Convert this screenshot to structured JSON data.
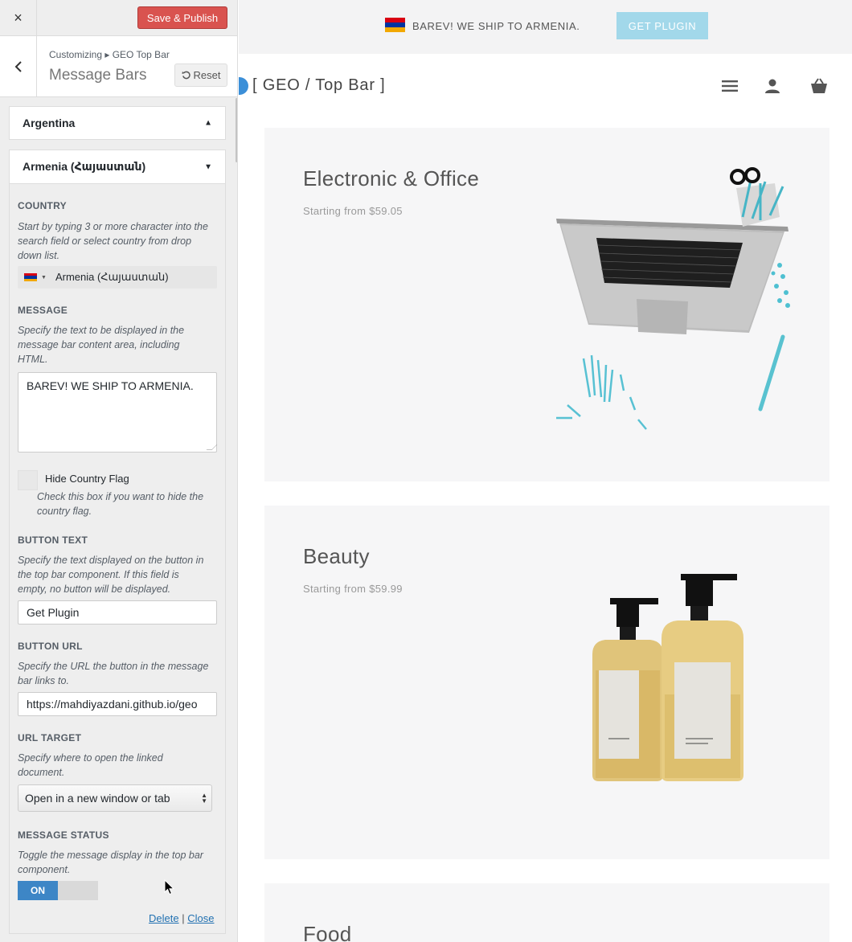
{
  "customizer": {
    "close_icon": "×",
    "save_label": "Save & Publish",
    "breadcrumb": "Customizing ▸ GEO Top Bar",
    "section_title": "Message Bars",
    "reset_label": "Reset",
    "accordions": [
      {
        "title": "Argentina",
        "state": "collapsed"
      },
      {
        "title": "Armenia (Հայաստան)",
        "state": "expanded"
      }
    ],
    "form": {
      "country": {
        "label": "COUNTRY",
        "description": "Start by typing 3 or more character into the search field or select country from drop down list.",
        "value": "Armenia (Հայաստան)"
      },
      "message": {
        "label": "MESSAGE",
        "description": "Specify the text to be displayed in the message bar content area, including HTML.",
        "value": "BAREV! WE SHIP TO ARMENIA."
      },
      "hide_flag": {
        "label": "Hide Country Flag",
        "description": "Check this box if you want to hide the country flag.",
        "checked": false
      },
      "button_text": {
        "label": "BUTTON TEXT",
        "description": "Specify the text displayed on the button in the top bar component. If this field is empty, no button will be displayed.",
        "value": "Get Plugin"
      },
      "button_url": {
        "label": "BUTTON URL",
        "description": "Specify the URL the button in the message bar links to.",
        "value": "https://mahdiyazdani.github.io/geo"
      },
      "url_target": {
        "label": "URL TARGET",
        "description": "Specify where to open the linked document.",
        "value": "Open in a new window or tab"
      },
      "message_status": {
        "label": "MESSAGE STATUS",
        "description": "Toggle the message display in the top bar component.",
        "toggle_label": "ON",
        "on": true
      },
      "delete_label": "Delete",
      "separator": "|",
      "close_label": "Close"
    }
  },
  "preview": {
    "topbar": {
      "flag_colors": [
        "#d90012",
        "#0033a0",
        "#f2a800"
      ],
      "message": "BAREV! WE SHIP TO ARMENIA.",
      "button": "GET PLUGIN",
      "button_color": "#a2d8ea"
    },
    "site_title": "[ GEO / Top Bar ]",
    "nav_icons": [
      "menu-icon",
      "user-icon",
      "basket-icon"
    ],
    "cards": [
      {
        "title": "Electronic & Office",
        "subtitle": "Starting from $59.05",
        "image": "laptop-desk-image"
      },
      {
        "title": "Beauty",
        "subtitle": "Starting from $59.99",
        "image": "soap-bottles-image"
      },
      {
        "title": "Food",
        "subtitle": "",
        "image": ""
      }
    ]
  },
  "colors": {
    "accent": "#3d86c6",
    "publish": "#d9534f",
    "card_bg": "#f6f6f7"
  }
}
